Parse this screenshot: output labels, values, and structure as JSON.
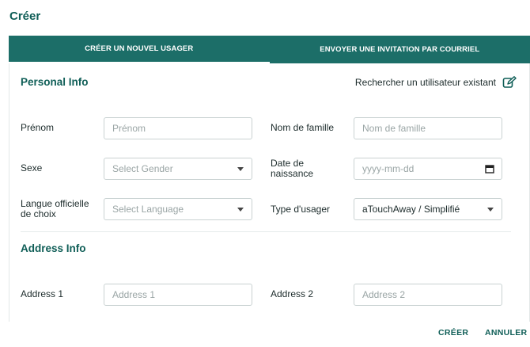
{
  "dialog": {
    "title": "Créer"
  },
  "tabs": [
    {
      "label": "CRÉER UN NOUVEL USAGER",
      "active": true
    },
    {
      "label": "ENVOYER UNE INVITATION PAR COURRIEL",
      "active": false
    }
  ],
  "personal": {
    "title": "Personal Info",
    "search_link": "Rechercher un utilisateur existant",
    "first_name": {
      "label": "Prénom",
      "placeholder": "Prénom",
      "value": ""
    },
    "last_name": {
      "label": "Nom de famille",
      "placeholder": "Nom de famille",
      "value": ""
    },
    "gender": {
      "label": "Sexe",
      "placeholder": "Select Gender"
    },
    "birth_date": {
      "label": "Date de naissance",
      "placeholder": "yyyy-mm-dd"
    },
    "language": {
      "label": "Langue officielle de choix",
      "placeholder": "Select Language"
    },
    "user_type": {
      "label": "Type d'usager",
      "value": "aTouchAway / Simplifié"
    }
  },
  "address": {
    "title": "Address Info",
    "address1": {
      "label": "Address 1",
      "placeholder": "Address 1"
    },
    "address2": {
      "label": "Address 2",
      "placeholder": "Address 2"
    }
  },
  "footer": {
    "create_label": "CRÉER",
    "cancel_label": "ANNULER"
  },
  "colors": {
    "accent": "#1c6e68",
    "title": "#0f5e57"
  },
  "icons": {
    "edit": "edit-icon",
    "calendar": "calendar-icon",
    "dropdown": "chevron-down-icon"
  }
}
